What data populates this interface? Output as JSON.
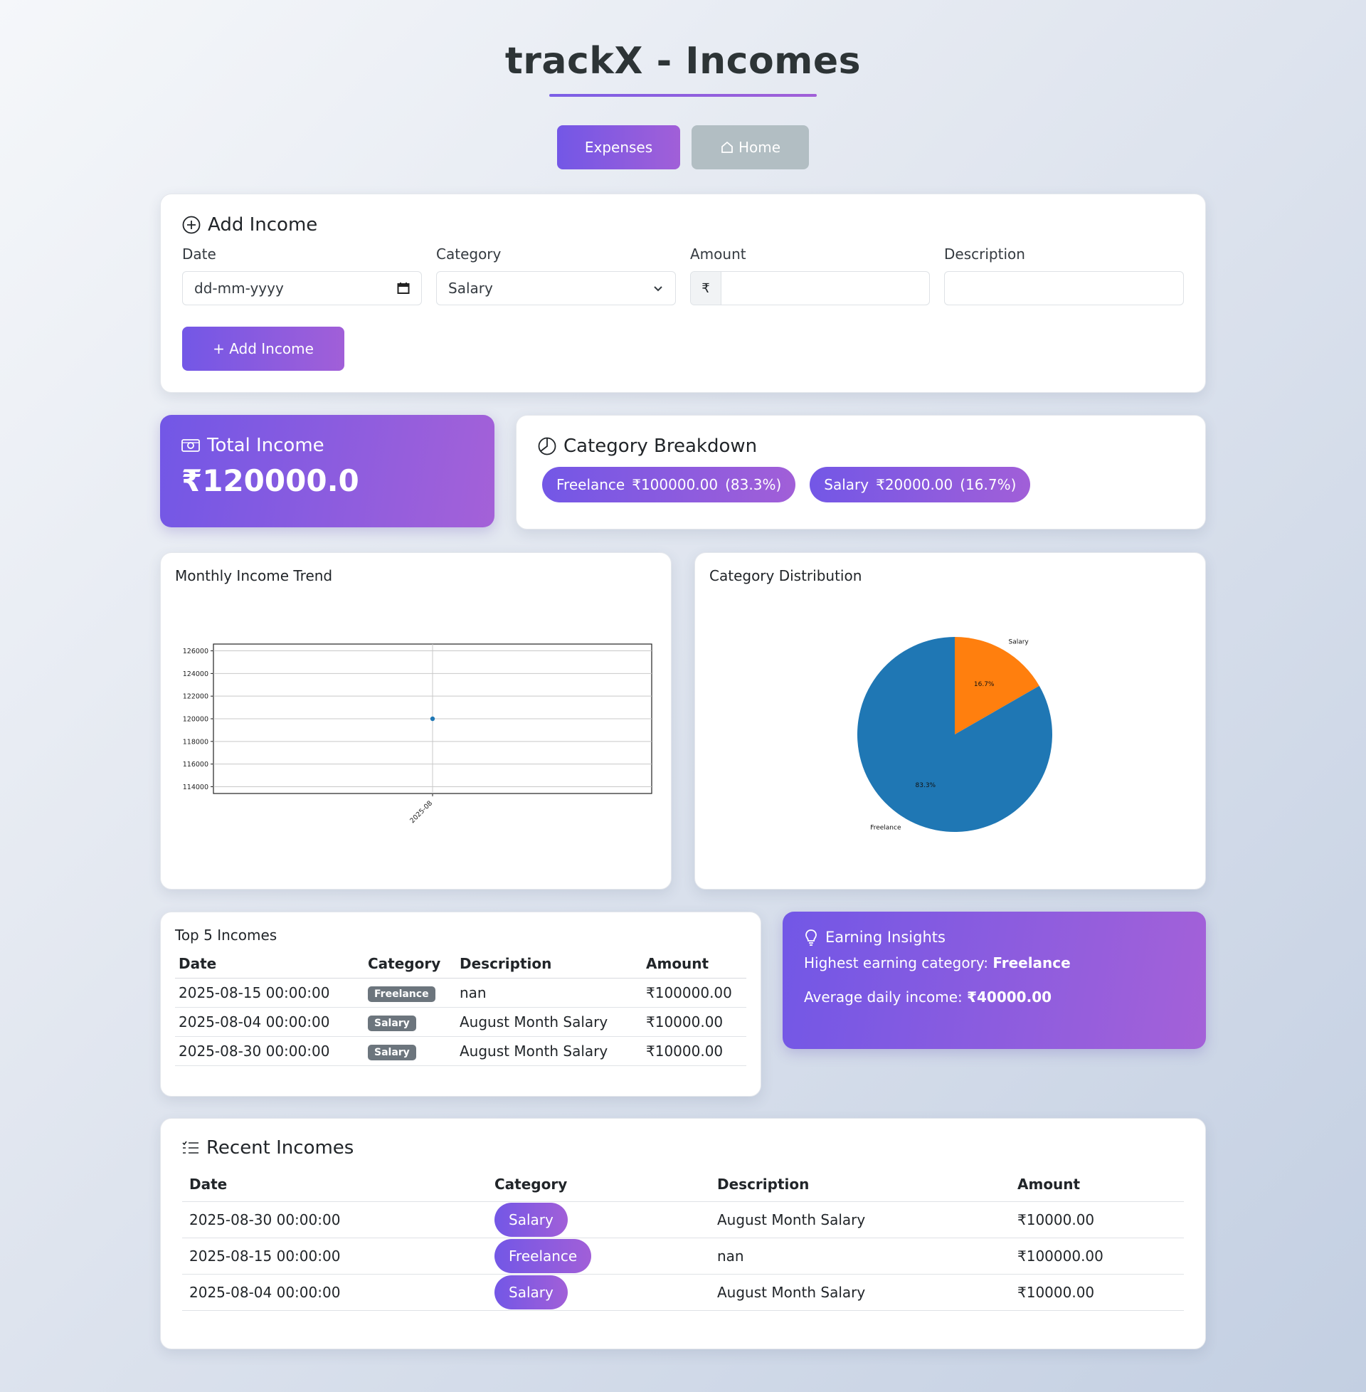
{
  "app": {
    "title": "trackX - Incomes"
  },
  "nav": {
    "expenses_label": "Expenses",
    "home_label": "Home",
    "home_icon": "house-icon"
  },
  "add_income": {
    "title": "Add Income",
    "fields": {
      "date": {
        "label": "Date",
        "placeholder": "dd-mm-yyyy"
      },
      "category": {
        "label": "Category",
        "value": "Salary"
      },
      "amount": {
        "label": "Amount",
        "prefix": "₹",
        "value": ""
      },
      "description": {
        "label": "Description",
        "value": ""
      }
    },
    "submit_label": "+ Add Income"
  },
  "total_income": {
    "title": "Total Income",
    "value": "₹120000.0"
  },
  "category_breakdown": {
    "title": "Category Breakdown",
    "items": [
      {
        "name": "Freelance",
        "amount": "₹100000.00",
        "percent": "(83.3%)"
      },
      {
        "name": "Salary",
        "amount": "₹20000.00",
        "percent": "(16.7%)"
      }
    ]
  },
  "charts": {
    "trend_title": "Monthly Income Trend",
    "distribution_title": "Category Distribution"
  },
  "chart_data": [
    {
      "type": "line",
      "x": [
        "2025-08"
      ],
      "series": [
        {
          "values": [
            120000
          ]
        }
      ],
      "yticks": [
        "114000",
        "116000",
        "118000",
        "120000",
        "122000",
        "124000",
        "126000"
      ],
      "ylim": [
        113400,
        126600
      ],
      "grid": true
    },
    {
      "type": "pie",
      "categories": [
        "Salary",
        "Freelance"
      ],
      "values": [
        16.7,
        83.3
      ],
      "labels": [
        "16.7%",
        "83.3%"
      ],
      "colors": [
        "#ff7f0e",
        "#1f77b4"
      ]
    }
  ],
  "top5": {
    "title": "Top 5 Incomes",
    "headers": [
      "Date",
      "Category",
      "Description",
      "Amount"
    ],
    "rows": [
      {
        "date": "2025-08-15 00:00:00",
        "category": "Freelance",
        "description": "nan",
        "amount": "₹100000.00"
      },
      {
        "date": "2025-08-04 00:00:00",
        "category": "Salary",
        "description": "August Month Salary",
        "amount": "₹10000.00"
      },
      {
        "date": "2025-08-30 00:00:00",
        "category": "Salary",
        "description": "August Month Salary",
        "amount": "₹10000.00"
      }
    ]
  },
  "insights": {
    "title": "Earning Insights",
    "highest_label": "Highest earning category:",
    "highest_value": "Freelance",
    "average_label": "Average daily income:",
    "average_value": "₹40000.00"
  },
  "recent": {
    "title": "Recent Incomes",
    "headers": [
      "Date",
      "Category",
      "Description",
      "Amount"
    ],
    "rows": [
      {
        "date": "2025-08-30 00:00:00",
        "category": "Salary",
        "description": "August Month Salary",
        "amount": "₹10000.00"
      },
      {
        "date": "2025-08-15 00:00:00",
        "category": "Freelance",
        "description": "nan",
        "amount": "₹100000.00"
      },
      {
        "date": "2025-08-04 00:00:00",
        "category": "Salary",
        "description": "August Month Salary",
        "amount": "₹10000.00"
      }
    ]
  }
}
